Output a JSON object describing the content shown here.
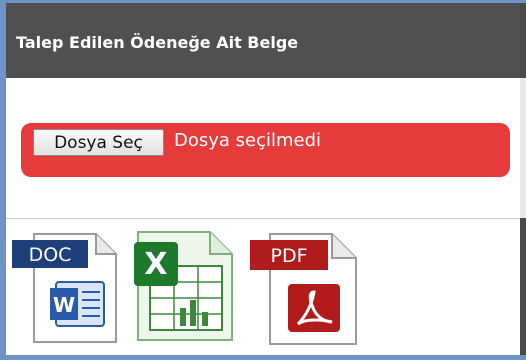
{
  "section": {
    "title": "Talep Edilen Ödeneğe Ait Belge"
  },
  "upload": {
    "button_label": "Dosya Seç",
    "status_text": "Dosya seçilmedi",
    "bar_color": "#e53b3b"
  },
  "file_types": [
    {
      "label": "DOC",
      "icon": "word-doc-icon"
    },
    {
      "label": "",
      "icon": "excel-xls-icon"
    },
    {
      "label": "PDF",
      "icon": "pdf-icon"
    }
  ]
}
